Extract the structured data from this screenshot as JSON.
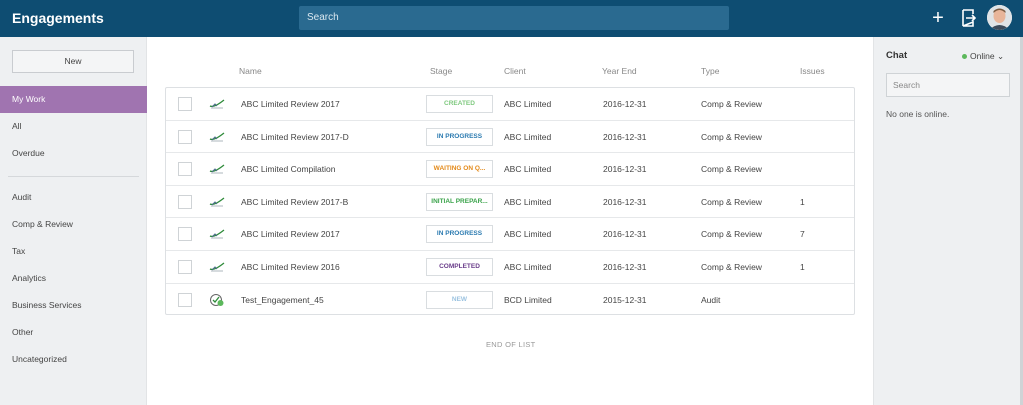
{
  "header": {
    "title": "Engagements",
    "search_placeholder": "Search",
    "add_icon": "plus-icon",
    "exit_icon": "exit-icon",
    "avatar_icon": "user-avatar"
  },
  "sidebar": {
    "new_label": "New",
    "items": [
      {
        "label": "My Work",
        "active": true
      },
      {
        "label": "All"
      },
      {
        "label": "Overdue"
      },
      {
        "label": "Audit"
      },
      {
        "label": "Comp & Review"
      },
      {
        "label": "Tax"
      },
      {
        "label": "Analytics"
      },
      {
        "label": "Business Services"
      },
      {
        "label": "Other"
      },
      {
        "label": "Uncategorized"
      }
    ]
  },
  "table": {
    "columns": [
      "Name",
      "Stage",
      "Client",
      "Year End",
      "Type",
      "Issues"
    ],
    "rows": [
      {
        "name": "ABC Limited Review 2017",
        "stage": "CREATED",
        "stage_color": "#7fc97f",
        "client": "ABC Limited",
        "year_end": "2016-12-31",
        "type": "Comp & Review",
        "issues": "",
        "icon": "review-check-icon"
      },
      {
        "name": "ABC Limited Review 2017-D",
        "stage": "IN PROGRESS",
        "stage_color": "#2a7ab0",
        "client": "ABC Limited",
        "year_end": "2016-12-31",
        "type": "Comp & Review",
        "issues": "",
        "icon": "review-check-icon"
      },
      {
        "name": "ABC Limited Compilation",
        "stage": "WAITING ON Q...",
        "stage_color": "#e38a1a",
        "client": "ABC Limited",
        "year_end": "2016-12-31",
        "type": "Comp & Review",
        "issues": "",
        "icon": "review-check-icon"
      },
      {
        "name": "ABC Limited Review 2017-B",
        "stage": "INITIAL PREPAR...",
        "stage_color": "#3aa34a",
        "client": "ABC Limited",
        "year_end": "2016-12-31",
        "type": "Comp & Review",
        "issues": "1",
        "icon": "review-check-icon"
      },
      {
        "name": "ABC Limited Review 2017",
        "stage": "IN PROGRESS",
        "stage_color": "#2a7ab0",
        "client": "ABC Limited",
        "year_end": "2016-12-31",
        "type": "Comp & Review",
        "issues": "7",
        "icon": "review-check-icon"
      },
      {
        "name": "ABC Limited Review 2016",
        "stage": "COMPLETED",
        "stage_color": "#6a3d8a",
        "client": "ABC Limited",
        "year_end": "2016-12-31",
        "type": "Comp & Review",
        "issues": "1",
        "icon": "review-check-icon"
      },
      {
        "name": "Test_Engagement_45",
        "stage": "NEW",
        "stage_color": "#9cc3e0",
        "client": "BCD Limited",
        "year_end": "2015-12-31",
        "type": "Audit",
        "issues": "",
        "icon": "audit-globe-icon"
      }
    ],
    "end_label": "END OF LIST"
  },
  "chat": {
    "title": "Chat",
    "status": "Online",
    "search_placeholder": "Search",
    "empty_text": "No one is online."
  }
}
